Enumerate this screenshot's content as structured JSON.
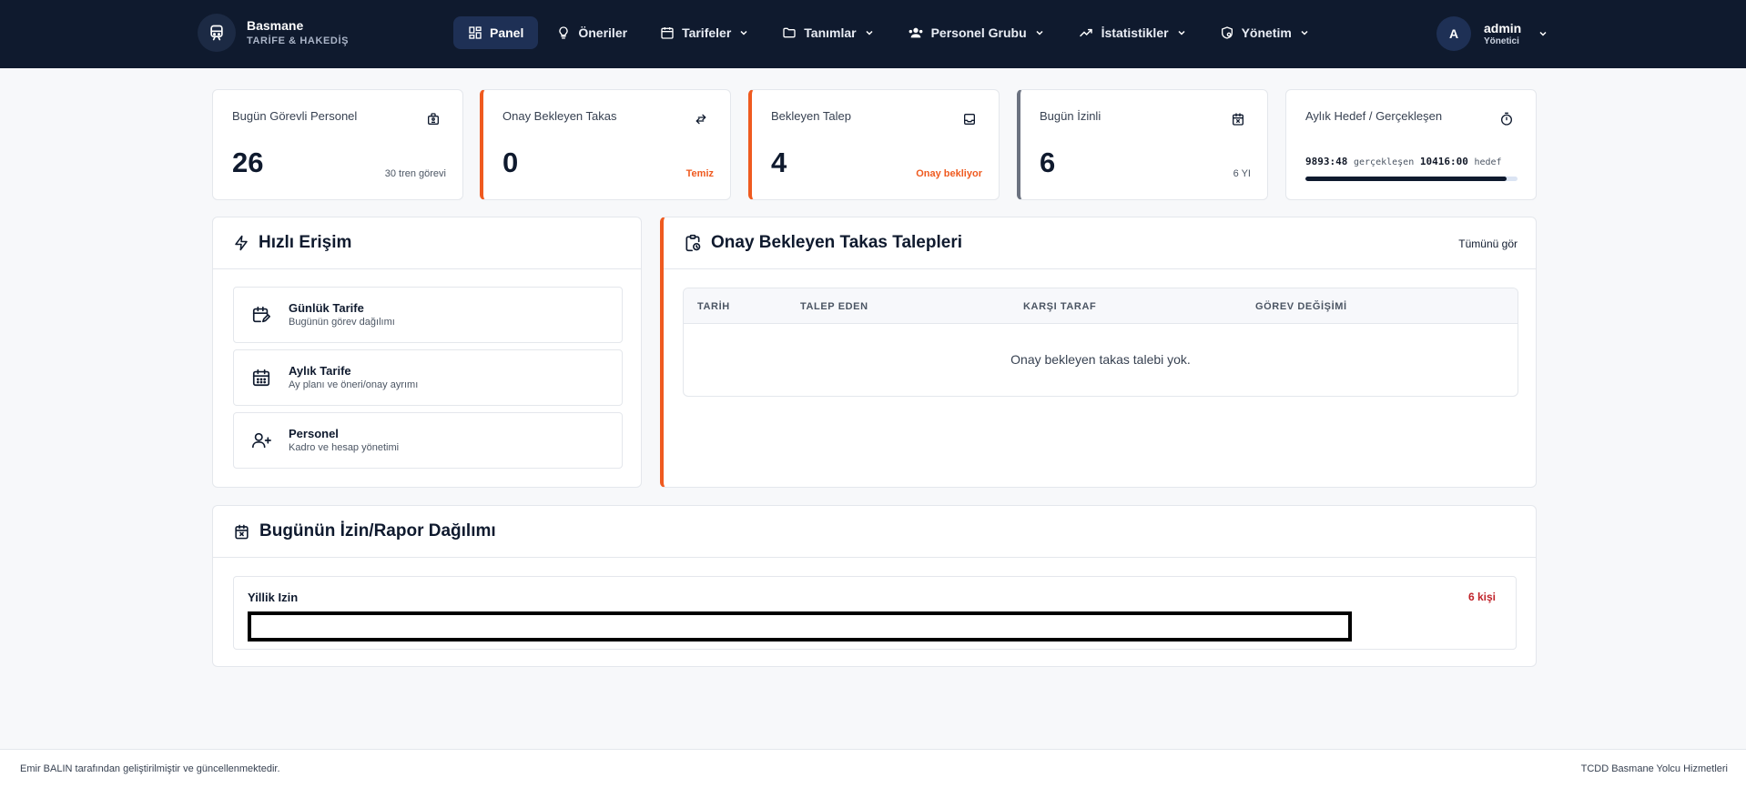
{
  "brand": {
    "name": "Basmane",
    "subtitle": "TARİFE & HAKEDİŞ",
    "icon": "train-icon"
  },
  "nav": {
    "items": [
      {
        "label": "Panel",
        "icon": "dashboard-icon",
        "active": true
      },
      {
        "label": "Öneriler",
        "icon": "lightbulb-icon"
      },
      {
        "label": "Tarifeler",
        "icon": "calendar-icon",
        "dropdown": true
      },
      {
        "label": "Tanımlar",
        "icon": "folder-icon",
        "dropdown": true
      },
      {
        "label": "Personel Grubu",
        "icon": "users-icon",
        "dropdown": true
      },
      {
        "label": "İstatistikler",
        "icon": "chart-line-icon",
        "dropdown": true
      },
      {
        "label": "Yönetim",
        "icon": "shield-gear-icon",
        "dropdown": true
      }
    ]
  },
  "user": {
    "initial": "A",
    "name": "admin",
    "role": "Yönetici"
  },
  "stats": {
    "on_duty": {
      "label": "Bugün Görevli Personel",
      "value": "26",
      "note": "30 tren görevi",
      "icon": "id-badge-icon"
    },
    "pending_swap": {
      "label": "Onay Bekleyen Takas",
      "value": "0",
      "note": "Temiz",
      "icon": "swap-icon"
    },
    "pending_request": {
      "label": "Bekleyen Talep",
      "value": "4",
      "note": "Onay bekliyor",
      "icon": "inbox-icon"
    },
    "on_leave": {
      "label": "Bugün İzinli",
      "value": "6",
      "note": "6 YI",
      "icon": "calendar-x-icon"
    },
    "monthly_goal": {
      "label": "Aylık Hedef / Gerçekleşen",
      "actual": "9893:48",
      "actual_label": "gerçekleşen",
      "target": "10416:00",
      "target_label": "hedef",
      "progress_percent": 95,
      "icon": "stopwatch-icon"
    }
  },
  "quick_access": {
    "title": "Hızlı Erişim",
    "items": [
      {
        "title": "Günlük Tarife",
        "subtitle": "Bugünün görev dağılımı",
        "icon": "calendar-edit-icon"
      },
      {
        "title": "Aylık Tarife",
        "subtitle": "Ay planı ve öneri/onay ayrımı",
        "icon": "calendar-grid-icon"
      },
      {
        "title": "Personel",
        "subtitle": "Kadro ve hesap yönetimi",
        "icon": "user-add-icon"
      }
    ]
  },
  "swap_requests": {
    "title": "Onay Bekleyen Takas Talepleri",
    "see_all": "Tümünü gör",
    "columns": [
      "TARİH",
      "TALEP EDEN",
      "KARŞI TARAF",
      "GÖREV DEĞİŞİMİ"
    ],
    "empty": "Onay bekleyen takas talebi yok."
  },
  "leave_distribution": {
    "title": "Bugünün İzin/Rapor Dağılımı",
    "rows": [
      {
        "label": "Yillik Izin",
        "count": "6 kişi"
      }
    ]
  },
  "footer": {
    "left": "Emir BALIN tarafından geliştirilmiştir ve güncellenmektedir.",
    "right": "TCDD Basmane Yolcu Hizmetleri"
  },
  "colors": {
    "navbar": "#0f1a2e",
    "accent": "#ef5a1f",
    "danger": "#c0232a",
    "nav_active": "#1e3055"
  }
}
